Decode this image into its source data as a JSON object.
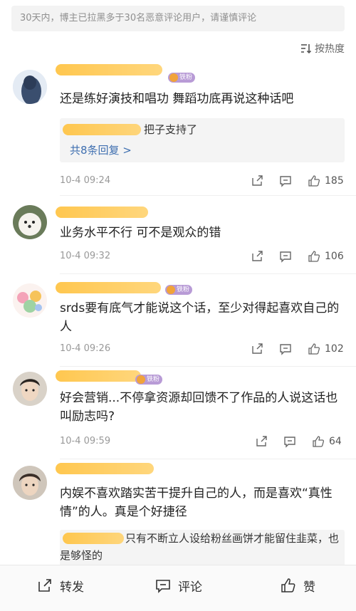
{
  "notice": "30天内，博主已拉黑多于30名恶意评论用户，请谨慎评论",
  "sort_label": "按热度",
  "comments": [
    {
      "badge": "铁粉",
      "text": "还是练好演技和唱功 舞蹈功底再说这种话吧",
      "reply_text": "把子支持了",
      "reply_more": "共8条回复 >",
      "time": "10-4 09:24",
      "likes": "185"
    },
    {
      "badge": "",
      "text": "业务水平不行 可不是观众的错",
      "time": "10-4 09:32",
      "likes": "106"
    },
    {
      "badge": "铁粉",
      "text": "srds要有底气才能说这个话，至少对得起喜欢自己的人",
      "time": "10-4 09:26",
      "likes": "102"
    },
    {
      "badge": "铁粉",
      "text": "好会营销...不停拿资源却回馈不了作品的人说这话也叫励志吗?",
      "time": "10-4 09:59",
      "likes": "64"
    },
    {
      "badge": "",
      "text": "内娱不喜欢踏实苦干提升自己的人，而是喜欢“真性情”的人。真是个好捷径",
      "reply_text": "只有不断立人设给粉丝画饼才能留住韭菜，也是够怪的"
    }
  ],
  "bottom_bar": {
    "repost": "转发",
    "comment": "评论",
    "like": "赞"
  },
  "icons": [
    "sort-icon",
    "share-icon",
    "comment-icon",
    "thumb-up-icon"
  ]
}
